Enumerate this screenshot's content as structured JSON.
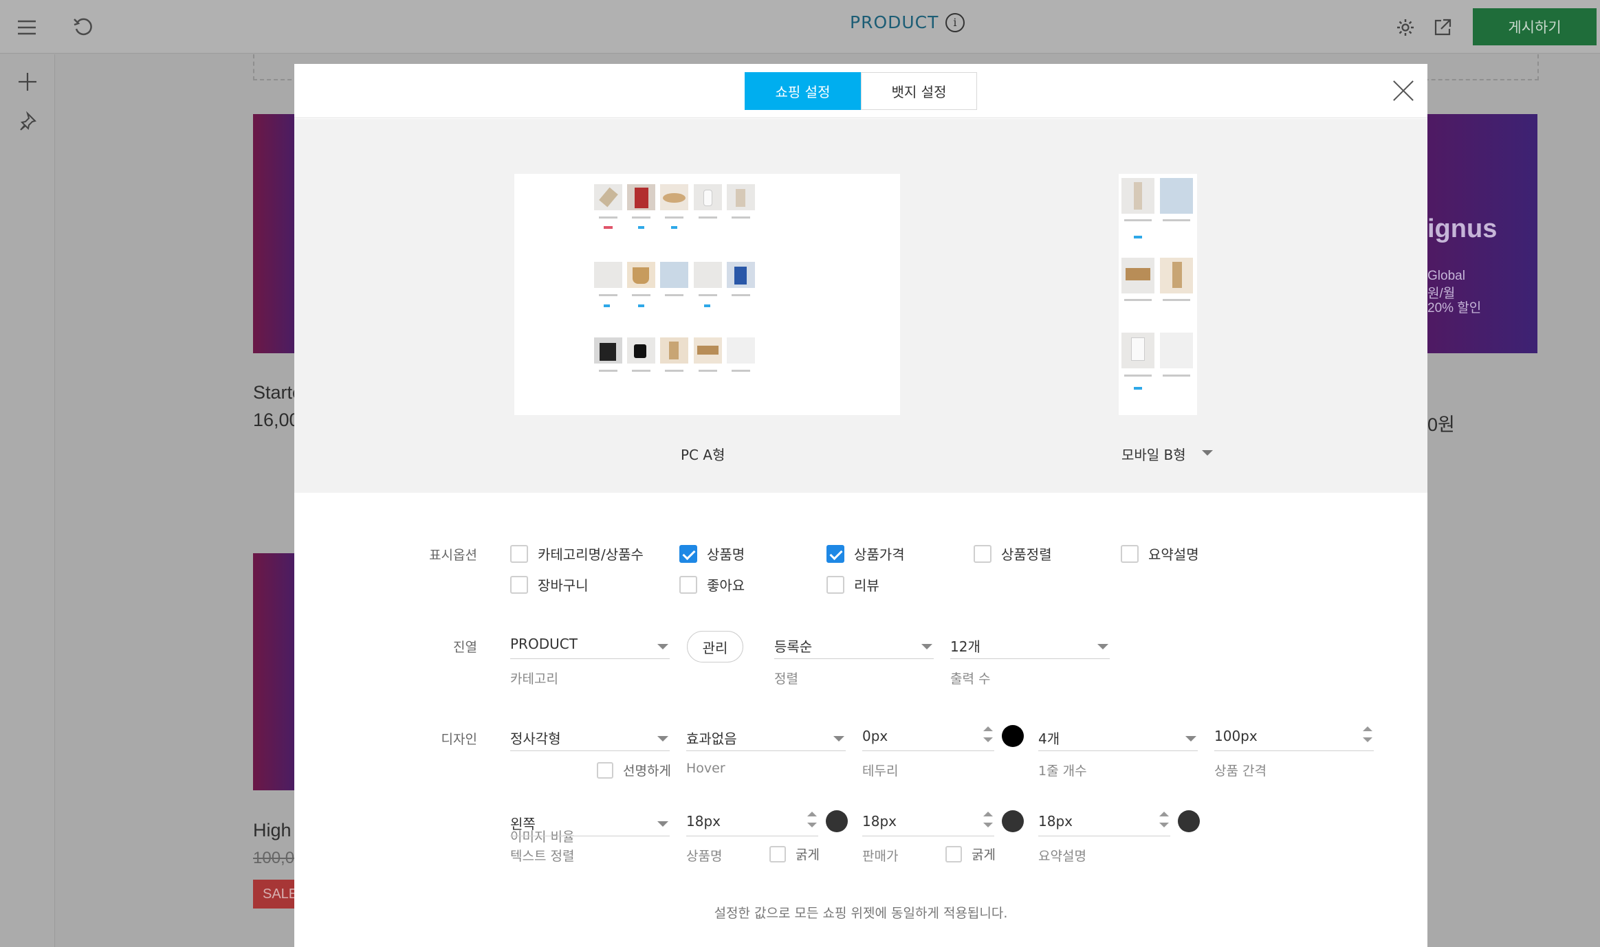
{
  "topbar": {
    "title": "PRODUCT",
    "info_glyph": "i",
    "publish_label": "게시하기",
    "icons": [
      "hamburger-menu-icon",
      "undo-icon",
      "gear-icon",
      "external-link-icon",
      "info-icon"
    ]
  },
  "leftbar": {
    "icons": [
      "plus-icon",
      "pin-icon"
    ]
  },
  "background": {
    "card1_title": "Starte",
    "card1_price": "16,00",
    "card2_title": "High",
    "card2_price": "100,0",
    "banner_brand": "ignus",
    "banner_line1": "Global",
    "banner_line2": "원/월",
    "banner_line3": "20% 할인",
    "right_price": "0원",
    "sale_badge": "SALE"
  },
  "modal": {
    "tabs": [
      {
        "label": "쇼핑 설정",
        "active": true
      },
      {
        "label": "뱃지 설정",
        "active": false
      }
    ],
    "preview": {
      "pc_label": "PC A형",
      "mobile_label": "모바일 B형"
    },
    "display_options": {
      "label": "표시옵션",
      "items": [
        {
          "label": "카테고리명/상품수",
          "checked": false
        },
        {
          "label": "상품명",
          "checked": true
        },
        {
          "label": "상품가격",
          "checked": true
        },
        {
          "label": "상품정렬",
          "checked": false
        },
        {
          "label": "요약설명",
          "checked": false
        },
        {
          "label": "장바구니",
          "checked": false
        },
        {
          "label": "좋아요",
          "checked": false
        },
        {
          "label": "리뷰",
          "checked": false
        }
      ]
    },
    "arrangement": {
      "label": "진열",
      "category_value": "PRODUCT",
      "category_sub": "카테고리",
      "manage_label": "관리",
      "sort_value": "등록순",
      "sort_sub": "정렬",
      "count_value": "12개",
      "count_sub": "출력 수"
    },
    "design": {
      "label": "디자인",
      "ratio_value": "정사각형",
      "ratio_sub": "이미지 비율",
      "sharp_label": "선명하게",
      "hover_value": "효과없음",
      "hover_sub": "Hover",
      "border_value": "0px",
      "border_sub": "테두리",
      "per_row_value": "4개",
      "per_row_sub": "1줄 개수",
      "gap_value": "100px",
      "gap_sub": "상품 간격",
      "align_value": "왼쪽",
      "align_sub": "텍스트 정렬",
      "name_size": "18px",
      "name_sub": "상품명",
      "bold_label": "굵게",
      "price_size": "18px",
      "price_sub": "판매가",
      "bold_label2": "굵게",
      "summary_size": "18px",
      "summary_sub": "요약설명",
      "colors": {
        "border_dot": "#000000",
        "name_dot": "#333333",
        "price_dot": "#333333",
        "summary_dot": "#333333"
      }
    },
    "note": "설정한 값으로 모든 쇼핑 위젯에 동일하게 적용됩니다."
  },
  "colors": {
    "accent_tab": "#00aeef",
    "checkbox": "#1e88e5",
    "publish": "#1f6d3a",
    "title": "#1c5d75"
  }
}
